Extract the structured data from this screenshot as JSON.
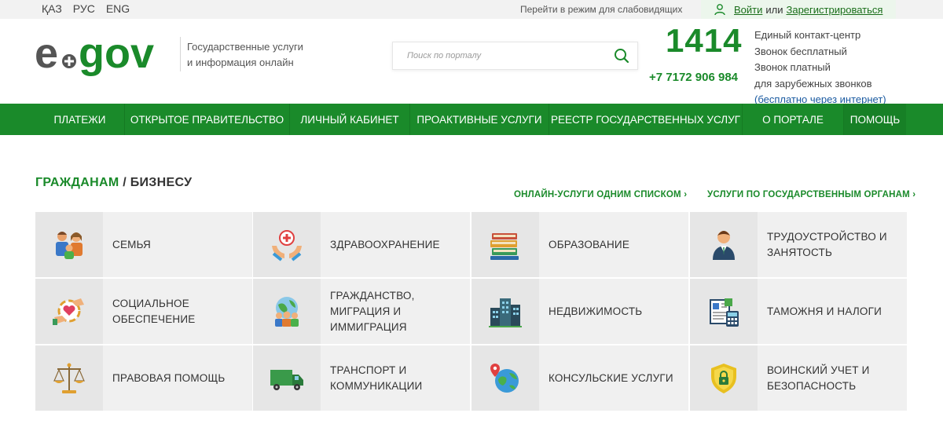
{
  "topbar": {
    "languages": [
      "ҚАЗ",
      "РУС",
      "ENG"
    ],
    "low_vision": "Перейти в режим для слабовидящих",
    "login": "Войти",
    "or": "или",
    "register": "Зарегистрироваться"
  },
  "header": {
    "tagline_line1": "Государственные услуги",
    "tagline_line2": "и информация онлайн",
    "search_placeholder": "Поиск по порталу",
    "hotline": "1414",
    "phone": "+7 7172 906 984",
    "contact_lines": [
      "Единый контакт-центр",
      "Звонок бесплатный",
      "Звонок платный",
      "для зарубежных звонков"
    ],
    "contact_free_net": "(бесплатно через интернет)"
  },
  "nav": {
    "items": [
      "ПЛАТЕЖИ",
      "ОТКРЫТОЕ ПРАВИТЕЛЬСТВО",
      "ЛИЧНЫЙ КАБИНЕТ",
      "ПРОАКТИВНЫЕ УСЛУГИ",
      "РЕЕСТР ГОСУДАРСТВЕННЫХ УСЛУГ",
      "О ПОРТАЛЕ",
      "ПОМОЩЬ"
    ]
  },
  "content": {
    "title_active": "ГРАЖДАНАМ",
    "title_sep": " / ",
    "title_other": "БИЗНЕСУ",
    "link_list": "ОНЛАЙН-УСЛУГИ ОДНИМ СПИСКОМ ›",
    "link_agencies": "УСЛУГИ ПО ГОСУДАРСТВЕННЫМ ОРГАНАМ ›",
    "tiles": [
      {
        "label": "СЕМЬЯ",
        "icon": "family-icon"
      },
      {
        "label": "ЗДРАВООХРАНЕНИЕ",
        "icon": "healthcare-icon"
      },
      {
        "label": "ОБРАЗОВАНИЕ",
        "icon": "books-icon"
      },
      {
        "label": "ТРУДОУСТРОЙСТВО И\nЗАНЯТОСТЬ",
        "icon": "worker-icon"
      },
      {
        "label": "СОЦИАЛЬНОЕ\nОБЕСПЕЧЕНИЕ",
        "icon": "social-care-icon"
      },
      {
        "label": "ГРАЖДАНСТВО,\nМИГРАЦИЯ И\nИММИГРАЦИЯ",
        "icon": "globe-people-icon"
      },
      {
        "label": "НЕДВИЖИМОСТЬ",
        "icon": "buildings-icon"
      },
      {
        "label": "ТАМОЖНЯ И НАЛОГИ",
        "icon": "tax-calculator-icon"
      },
      {
        "label": "ПРАВОВАЯ ПОМОЩЬ",
        "icon": "scales-icon"
      },
      {
        "label": "ТРАНСПОРТ И\nКОММУНИКАЦИИ",
        "icon": "truck-icon"
      },
      {
        "label": "КОНСУЛЬСКИЕ УСЛУГИ",
        "icon": "globe-pin-icon"
      },
      {
        "label": "ВОИНСКИЙ УЧЕТ И\nБЕЗОПАСНОСТЬ",
        "icon": "shield-lock-icon"
      }
    ]
  },
  "colors": {
    "brand_green": "#1a8a2a",
    "logo_gray": "#555555",
    "tile_icon_bg": "#e6e6e6",
    "tile_label_bg": "#f0f0f0"
  }
}
